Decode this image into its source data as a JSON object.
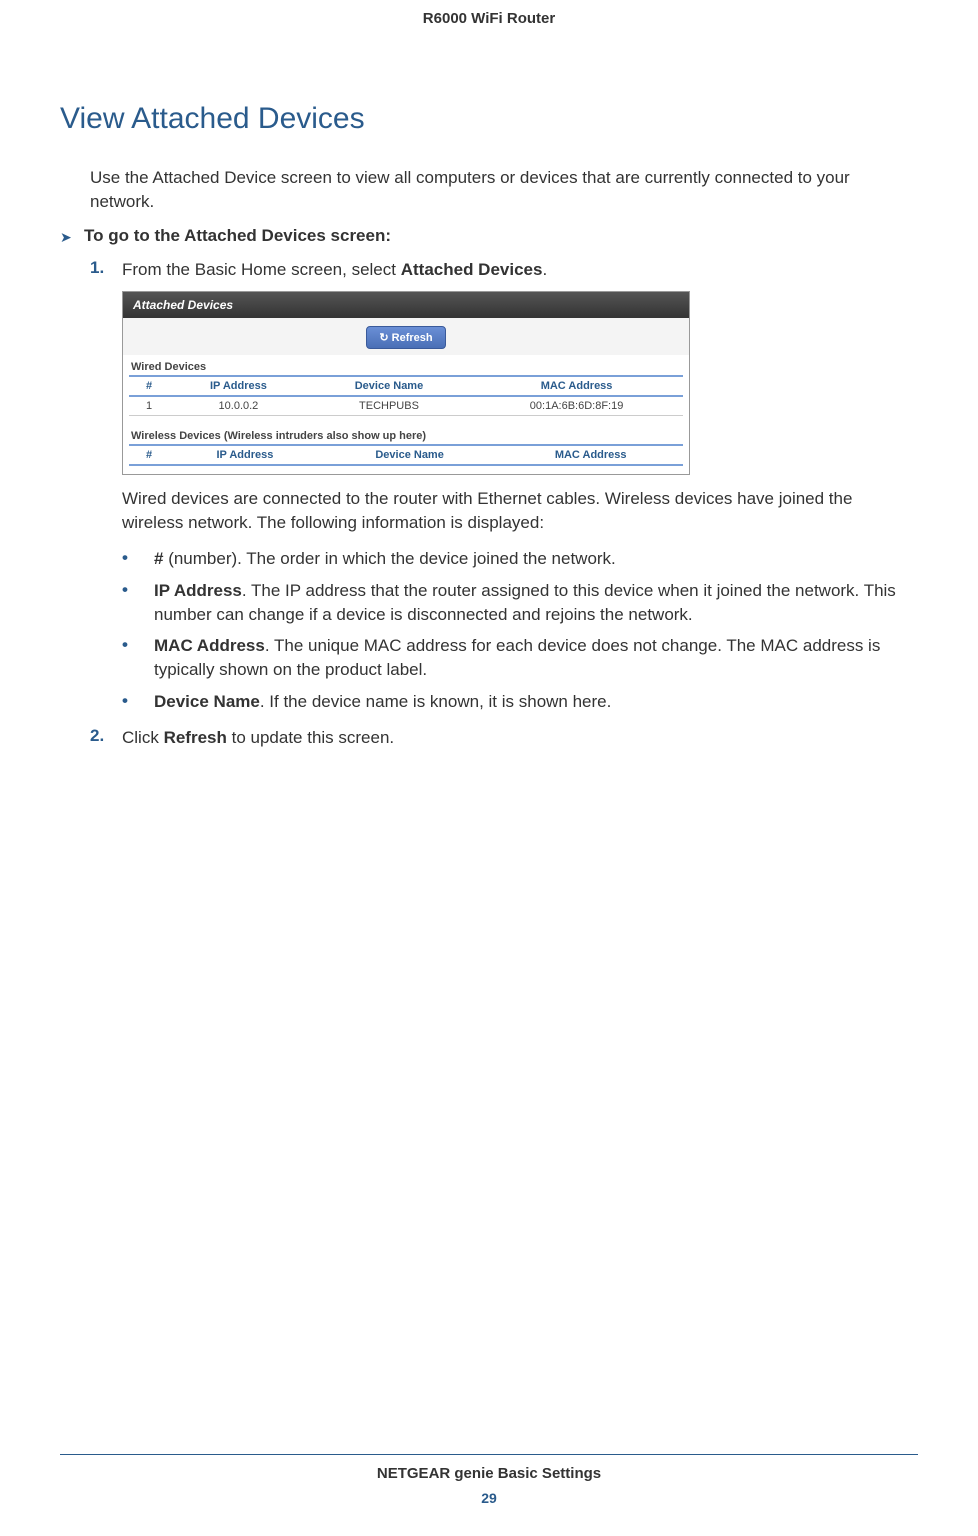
{
  "header": {
    "product": "R6000 WiFi Router"
  },
  "title": "View Attached Devices",
  "intro": "Use the Attached Device screen to view all computers or devices that are currently connected to your network.",
  "procedure_heading": "To go to the Attached Devices screen:",
  "steps": {
    "s1_num": "1.",
    "s1_a": "From the Basic Home screen, select ",
    "s1_b": "Attached Devices",
    "s1_c": ".",
    "s2_num": "2.",
    "s2_a": "Click ",
    "s2_b": "Refresh",
    "s2_c": " to update this screen."
  },
  "figure": {
    "header": "Attached Devices",
    "refresh": "Refresh",
    "wired_label": "Wired Devices",
    "wireless_label": "Wireless Devices (Wireless intruders also show up here)",
    "cols": {
      "num": "#",
      "ip": "IP Address",
      "name": "Device Name",
      "mac": "MAC Address"
    },
    "row": {
      "num": "1",
      "ip": "10.0.0.2",
      "name": "TECHPUBS",
      "mac": "00:1A:6B:6D:8F:19"
    }
  },
  "after_figure": "Wired devices are connected to the router with Ethernet cables. Wireless devices have joined the wireless network. The following information is displayed:",
  "bullets": {
    "b1_label": "#",
    "b1_text": " (number). The order in which the device joined the network.",
    "b2_label": "IP Address",
    "b2_text": ". The IP address that the router assigned to this device when it joined the network. This number can change if a device is disconnected and rejoins the network.",
    "b3_label": "MAC Address",
    "b3_text": ". The unique MAC address for each device does not change. The MAC address is typically shown on the product label.",
    "b4_label": "Device Name",
    "b4_text": ". If the device name is known, it is shown here."
  },
  "footer": {
    "title": "NETGEAR genie Basic Settings",
    "page": "29"
  }
}
